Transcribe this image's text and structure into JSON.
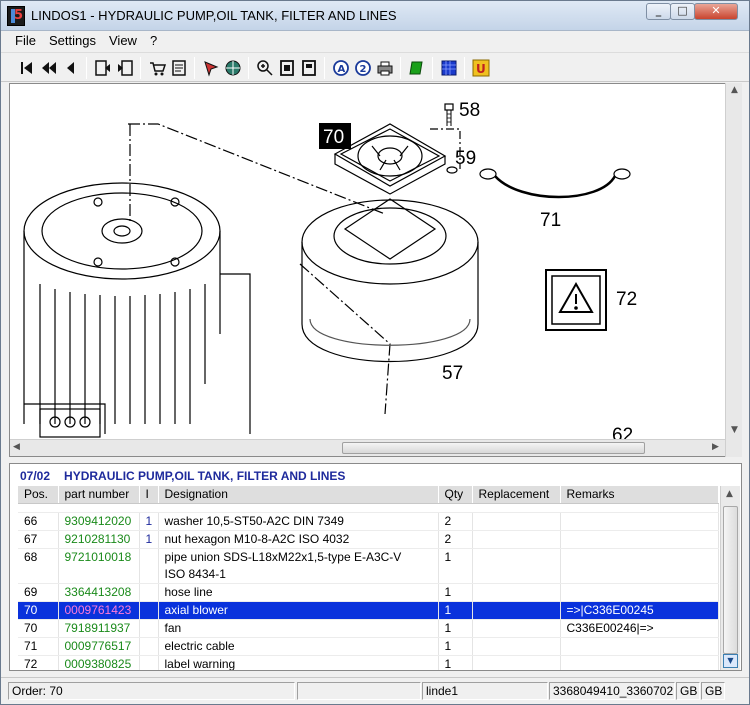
{
  "window": {
    "title": "LINDOS1 - HYDRAULIC PUMP,OIL TANK,  FILTER AND LINES"
  },
  "menu": [
    "File",
    "Settings",
    "View",
    "?"
  ],
  "toolbar": {
    "icons": [
      "first-icon",
      "previous-page-icon",
      "previous-icon",
      "bookmark-back-icon",
      "bookmark-forward-icon",
      "cart-icon",
      "checklist-icon",
      "pointer-icon",
      "globe-icon",
      "zoom-in-icon",
      "page-icon",
      "page-fit-icon",
      "info-a-icon",
      "info-2-icon",
      "print-icon",
      "green-book-icon",
      "blue-grid-icon",
      "u-icon"
    ]
  },
  "drawing": {
    "callouts": [
      "70",
      "58",
      "59",
      "71",
      "72",
      "57",
      "62"
    ]
  },
  "parts": {
    "section_code": "07/02",
    "section_title": "HYDRAULIC PUMP,OIL TANK,  FILTER AND LINES",
    "columns": [
      "Pos.",
      "part number",
      "I",
      "Designation",
      "Qty",
      "Replacement",
      "Remarks"
    ],
    "rows": [
      {
        "pos": "66",
        "part": "9309412020",
        "ind": "1",
        "desc": "washer 10,5-ST50-A2C  DIN 7349",
        "desc2": "",
        "qty": "2",
        "repl": "",
        "remarks": ""
      },
      {
        "pos": "67",
        "part": "9210281130",
        "ind": "1",
        "desc": "nut hexagon M10-8-A2C  ISO 4032",
        "desc2": "",
        "qty": "2",
        "repl": "",
        "remarks": ""
      },
      {
        "pos": "68",
        "part": "9721010018",
        "ind": "",
        "desc": "pipe union SDS-L18xM22x1,5-type E-A3C-V",
        "desc2": "ISO 8434-1",
        "qty": "1",
        "repl": "",
        "remarks": ""
      },
      {
        "pos": "69",
        "part": "3364413208",
        "ind": "",
        "desc": "hose line",
        "desc2": "",
        "qty": "1",
        "repl": "",
        "remarks": ""
      },
      {
        "pos": "70",
        "part": "0009761423",
        "ind": "",
        "desc": "axial blower",
        "desc2": "",
        "qty": "1",
        "repl": "",
        "remarks": "=>|C336E00245",
        "selected": true
      },
      {
        "pos": "70",
        "part": "7918911937",
        "ind": "",
        "desc": "fan",
        "desc2": "",
        "qty": "1",
        "repl": "",
        "remarks": "C336E00246|=>"
      },
      {
        "pos": "71",
        "part": "0009776517",
        "ind": "",
        "desc": "electric cable",
        "desc2": "",
        "qty": "1",
        "repl": "",
        "remarks": ""
      },
      {
        "pos": "72",
        "part": "0009380825",
        "ind": "",
        "desc": "label warning",
        "desc2": "",
        "qty": "1",
        "repl": "",
        "remarks": ""
      }
    ]
  },
  "status": {
    "order": "Order: 70",
    "user": "linde1",
    "numbers": "3368049410_3360702",
    "lang1": "GB",
    "lang2": "GB"
  }
}
